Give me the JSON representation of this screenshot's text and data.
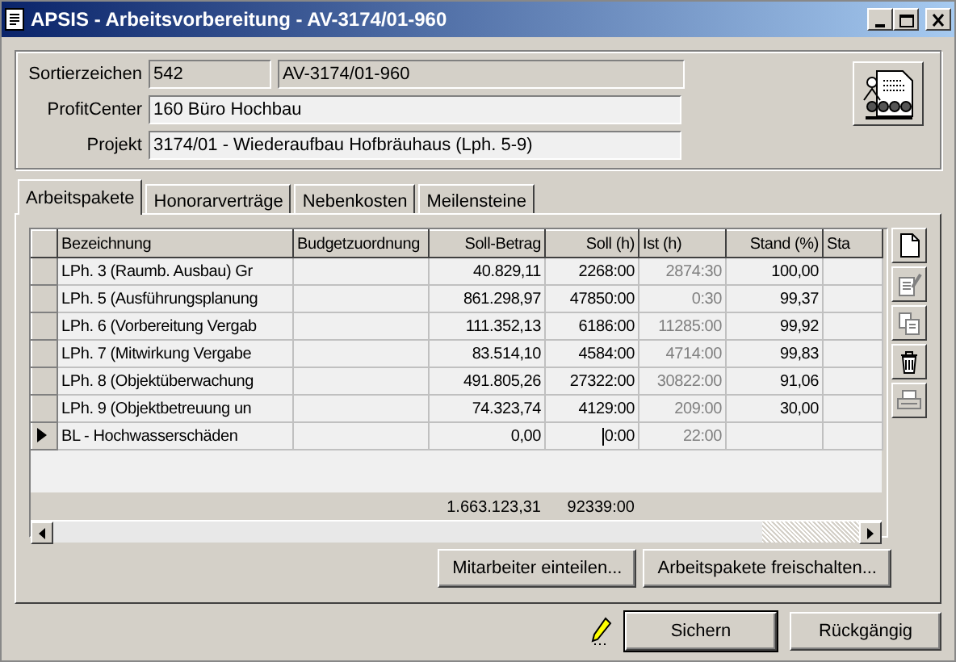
{
  "window": {
    "title": "APSIS - Arbeitsvorbereitung - AV-3174/01-960"
  },
  "header": {
    "fields": [
      {
        "label": "Sortierzeichen",
        "values": [
          "542",
          "AV-3174/01-960"
        ],
        "disabled": true
      },
      {
        "label": "ProfitCenter",
        "values": [
          "160 Büro Hochbau"
        ],
        "disabled": false
      },
      {
        "label": "Projekt",
        "values": [
          "3174/01  -  Wiederaufbau Hofbräuhaus (Lph. 5-9)"
        ],
        "disabled": false
      }
    ]
  },
  "tabs": [
    {
      "label": "Arbeitspakete",
      "selected": true
    },
    {
      "label": "Honorarverträge",
      "selected": false
    },
    {
      "label": "Nebenkosten",
      "selected": false
    },
    {
      "label": "Meilensteine",
      "selected": false
    }
  ],
  "table": {
    "columns": [
      {
        "label": "Bezeichnung",
        "kind": "text"
      },
      {
        "label": "Budgetzuordnung",
        "kind": "text"
      },
      {
        "label": "Soll-Betrag",
        "kind": "number",
        "total": "1.663.123,31"
      },
      {
        "label": "Soll (h)",
        "kind": "number",
        "total": "92339:00"
      },
      {
        "label": "Ist (h)",
        "kind": "computed"
      },
      {
        "label": "Stand (%)",
        "kind": "number"
      },
      {
        "label": "Sta",
        "kind": "text"
      }
    ],
    "rows": [
      {
        "current": false,
        "cells": [
          "LPh. 3 (Raumb. Ausbau) Gr",
          "",
          "40.829,11",
          "2268:00",
          "2874:30",
          "100,00",
          ""
        ]
      },
      {
        "current": false,
        "cells": [
          "LPh. 5 (Ausführungsplanung",
          "",
          "861.298,97",
          "47850:00",
          "0:30",
          "99,37",
          ""
        ]
      },
      {
        "current": false,
        "cells": [
          "LPh. 6 (Vorbereitung Vergab",
          "",
          "111.352,13",
          "6186:00",
          "11285:00",
          "99,92",
          ""
        ]
      },
      {
        "current": false,
        "cells": [
          "LPh. 7 (Mitwirkung Vergabe",
          "",
          "83.514,10",
          "4584:00",
          "4714:00",
          "99,83",
          ""
        ]
      },
      {
        "current": false,
        "cells": [
          "LPh. 8 (Objektüberwachung",
          "",
          "491.805,26",
          "27322:00",
          "30822:00",
          "91,06",
          ""
        ]
      },
      {
        "current": false,
        "cells": [
          "LPh. 9 (Objektbetreuung un",
          "",
          "74.323,74",
          "4129:00",
          "209:00",
          "30,00",
          ""
        ]
      },
      {
        "current": true,
        "cells": [
          "BL - Hochwasserschäden",
          "",
          "0,00",
          "0:00",
          "22:00",
          "",
          ""
        ]
      }
    ]
  },
  "toolbar": [
    {
      "kind": "new",
      "disabled": false
    },
    {
      "kind": "edit",
      "disabled": true
    },
    {
      "kind": "copy",
      "disabled": true
    },
    {
      "kind": "delete",
      "disabled": false
    },
    {
      "kind": "print",
      "disabled": true
    }
  ],
  "panel_buttons": [
    "Mitarbeiter einteilen...",
    "Arbeitspakete freischalten..."
  ],
  "buttons": [
    "Sichern",
    "Rückgängig"
  ]
}
